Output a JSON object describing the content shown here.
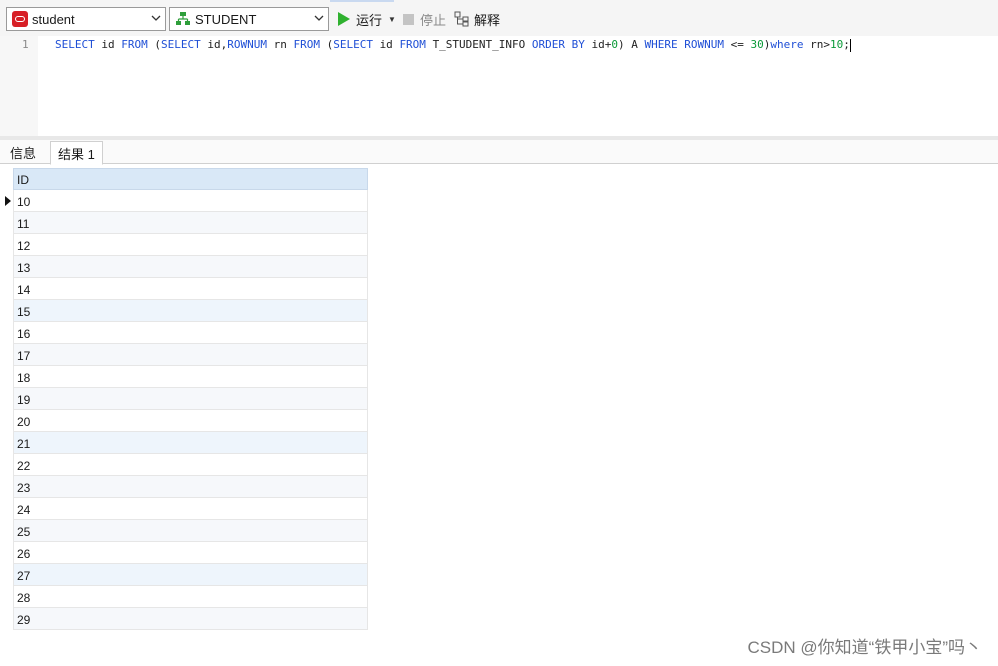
{
  "toolbar": {
    "connection": {
      "value": "student",
      "icon": "oracle-icon"
    },
    "schema": {
      "value": "STUDENT",
      "icon": "schema-icon"
    },
    "run_label": "运行",
    "stop_label": "停止",
    "explain_label": "解释"
  },
  "editor": {
    "line_number": "1",
    "tokens": [
      {
        "t": "SELECT ",
        "c": "kw"
      },
      {
        "t": "id ",
        "c": "txt"
      },
      {
        "t": "FROM ",
        "c": "kw"
      },
      {
        "t": "(",
        "c": "txt"
      },
      {
        "t": "SELECT ",
        "c": "kw"
      },
      {
        "t": "id,",
        "c": "txt"
      },
      {
        "t": "ROWNUM ",
        "c": "kw"
      },
      {
        "t": "rn ",
        "c": "txt"
      },
      {
        "t": "FROM ",
        "c": "kw"
      },
      {
        "t": "(",
        "c": "txt"
      },
      {
        "t": "SELECT ",
        "c": "kw"
      },
      {
        "t": "id ",
        "c": "txt"
      },
      {
        "t": "FROM ",
        "c": "kw"
      },
      {
        "t": "T_STUDENT_INFO ",
        "c": "txt"
      },
      {
        "t": "ORDER BY ",
        "c": "kw"
      },
      {
        "t": "id+",
        "c": "txt"
      },
      {
        "t": "0",
        "c": "num"
      },
      {
        "t": ") A ",
        "c": "txt"
      },
      {
        "t": "WHERE ",
        "c": "kw"
      },
      {
        "t": "ROWNUM ",
        "c": "kw"
      },
      {
        "t": "<= ",
        "c": "txt"
      },
      {
        "t": "30",
        "c": "num"
      },
      {
        "t": ")",
        "c": "txt"
      },
      {
        "t": "where ",
        "c": "kw"
      },
      {
        "t": "rn>",
        "c": "txt"
      },
      {
        "t": "10",
        "c": "num"
      },
      {
        "t": ";",
        "c": "txt"
      }
    ]
  },
  "tabs": [
    {
      "label": "信息",
      "active": false
    },
    {
      "label": "结果 1",
      "active": true
    }
  ],
  "grid": {
    "columns": [
      "ID"
    ],
    "rows": [
      "10",
      "11",
      "12",
      "13",
      "14",
      "15",
      "16",
      "17",
      "18",
      "19",
      "20",
      "21",
      "22",
      "23",
      "24",
      "25",
      "26",
      "27",
      "28",
      "29"
    ],
    "current_row": 0
  },
  "watermark": "CSDN @你知道“铁甲小宝”吗丶"
}
